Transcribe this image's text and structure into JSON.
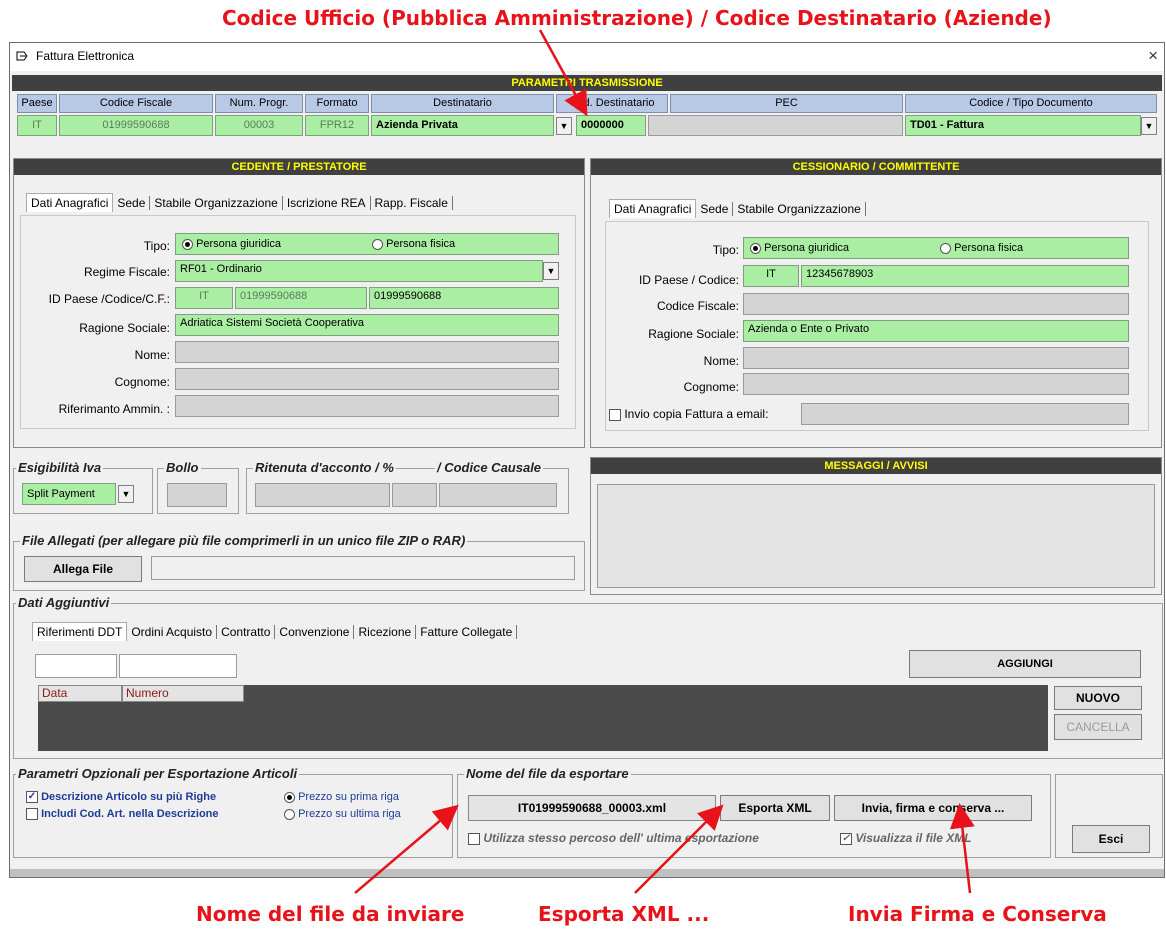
{
  "annotations": {
    "top": "Codice Ufficio (Pubblica Amministrazione) / Codice Destinatario (Aziende)",
    "bottom_left": "Nome del file da inviare",
    "bottom_mid": "Esporta XML ...",
    "bottom_right": "Invia Firma e Conserva"
  },
  "window": {
    "title": "Fattura Elettronica",
    "close": "×"
  },
  "trasmissione": {
    "title": "PARAMETRI TRASMISSIONE",
    "headers": [
      "Paese",
      "Codice Fiscale",
      "Num. Progr.",
      "Formato",
      "Destinatario",
      "Cod. Destinatario",
      "PEC",
      "Codice / Tipo Documento"
    ],
    "paese": "IT",
    "codice_fiscale": "01999590688",
    "num_progr": "00003",
    "formato": "FPR12",
    "destinatario": "Azienda Privata",
    "cod_destinatario": "0000000",
    "pec": "",
    "tipo_documento": "TD01 - Fattura"
  },
  "cedente": {
    "title": "CEDENTE / PRESTATORE",
    "tabs": [
      "Dati Anagrafici",
      "Sede",
      "Stabile Organizzazione",
      "Iscrizione REA",
      "Rapp. Fiscale"
    ],
    "labels": {
      "tipo": "Tipo:",
      "regime": "Regime Fiscale:",
      "id_paese": "ID Paese /Codice/C.F.:",
      "ragione": "Ragione Sociale:",
      "nome": "Nome:",
      "cognome": "Cognome:",
      "riferimento": "Riferimanto Ammin. :"
    },
    "tipo_options": [
      "Persona giuridica",
      "Persona fisica"
    ],
    "regime": "RF01 - Ordinario",
    "paese": "IT",
    "codice": "01999590688",
    "cf": "01999590688",
    "ragione_sociale": "Adriatica Sistemi Società Cooperativa"
  },
  "cessionario": {
    "title": "CESSIONARIO / COMMITTENTE",
    "tabs": [
      "Dati Anagrafici",
      "Sede",
      "Stabile Organizzazione"
    ],
    "labels": {
      "tipo": "Tipo:",
      "id_paese": "ID Paese / Codice:",
      "cf": "Codice Fiscale:",
      "ragione": "Ragione Sociale:",
      "nome": "Nome:",
      "cognome": "Cognome:",
      "invio": "Invio copia Fattura a email:"
    },
    "tipo_options": [
      "Persona giuridica",
      "Persona fisica"
    ],
    "paese": "IT",
    "codice": "12345678903",
    "ragione_sociale": "Azienda o Ente o Privato"
  },
  "iva": {
    "esigibilita_title": "Esigibilità Iva",
    "esigibilita": "Split Payment",
    "bollo_title": "Bollo",
    "ritenuta_title": "Ritenuta d'acconto /  %",
    "causale_title": "/ Codice Causale"
  },
  "messaggi": {
    "title": "MESSAGGI / AVVISI"
  },
  "allegati": {
    "title": "File Allegati  (per allegare più file comprimerli in un unico file ZIP o RAR)",
    "button": "Allega File"
  },
  "aggiuntivi": {
    "title": "Dati Aggiuntivi",
    "tabs": [
      "Riferimenti DDT",
      "Ordini Acquisto",
      "Contratto",
      "Convenzione",
      "Ricezione",
      "Fatture Collegate"
    ],
    "columns": [
      "Data",
      "Numero"
    ],
    "aggiungi": "AGGIUNGI",
    "nuovo": "NUOVO",
    "cancella": "CANCELLA"
  },
  "opzionali": {
    "title": "Parametri Opzionali per Esportazione Articoli",
    "chk1": "Descrizione Articolo su più Righe",
    "chk2": "Includi Cod. Art. nella Descrizione",
    "radio1": "Prezzo su prima riga",
    "radio2": "Prezzo su ultima riga"
  },
  "export": {
    "title": "Nome del file da esportare",
    "filename": "IT01999590688_00003.xml",
    "esporta": "Esporta XML",
    "invia": "Invia, firma e conserva ...",
    "stesso": "Utilizza stesso percoso dell' ultima esportazione",
    "visualizza": "Visualizza il file XML",
    "esci": "Esci"
  },
  "colors": {
    "green_field": "#a9eea3",
    "header_blue": "#b8c9e6",
    "dark_bar": "#404040",
    "yellow_text": "#ffff00",
    "annotation_red": "#e8121a"
  }
}
